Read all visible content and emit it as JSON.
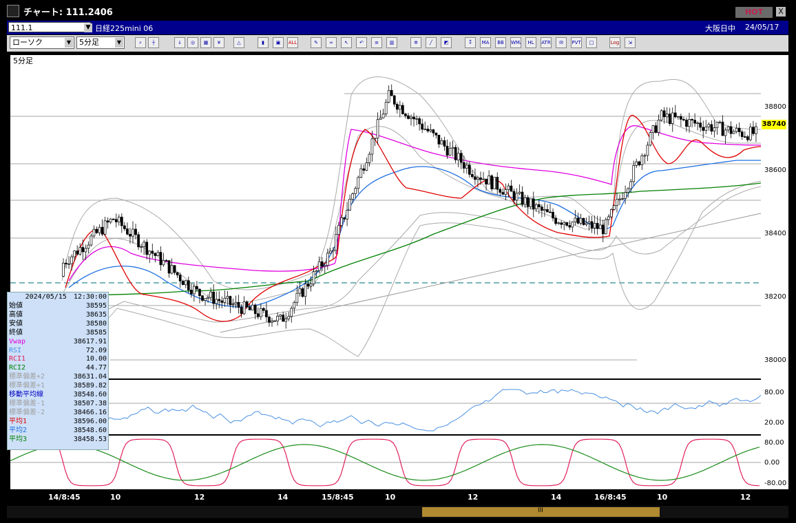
{
  "window": {
    "title": "チャート: 111.2406",
    "hot_label": "HOT",
    "close_label": "X"
  },
  "infobar": {
    "symbol": "111.1",
    "instrument": "日経225mini 06",
    "exchange": "大阪日中",
    "date": "24/05/17"
  },
  "toolbar": {
    "chart_type": "ローソク",
    "timeframe": "5分足",
    "icons": [
      "zoom-icon",
      "crosshair-icon",
      "download-icon",
      "search-icon",
      "grid-icon",
      "yen-icon",
      "drawing-icon",
      "candle-icon",
      "box-icon",
      "all-icon",
      "pencil-icon",
      "link-icon",
      "arrow-icon",
      "undo-icon",
      "list-icon",
      "trash-icon",
      "settings-icon",
      "eraser-icon",
      "color-icon",
      "ichimoku-icon",
      "ma-icon",
      "bb-icon",
      "wma-icon",
      "hl-icon",
      "atr-icon",
      "envelope-icon",
      "pvt-icon",
      "frame-icon",
      "log-icon",
      "export-icon"
    ],
    "icon_labels": {
      "all": "ALL",
      "ma": "MA",
      "bb": "BB",
      "wma": "WMA",
      "hl": "HL",
      "atr": "ATR",
      "pvt": "PVT",
      "log": "Log"
    }
  },
  "panel_label": "5分足",
  "price_axis": [
    "38800",
    "38600",
    "38400",
    "38200",
    "38000"
  ],
  "current_price": "38740",
  "rsi_axis": [
    "80.00",
    "20.00"
  ],
  "rci_axis": [
    "80.00",
    "0.00",
    "-80.00"
  ],
  "x_axis": [
    "14/8:45",
    "10",
    "12",
    "14",
    "15/8:45",
    "10",
    "12",
    "14",
    "16/8:45",
    "10",
    "12"
  ],
  "scroll_grip": "III",
  "info_panel": {
    "datetime": "2024/05/15　12:30:00",
    "rows": [
      {
        "label": "始値",
        "value": "38595",
        "color": "#000000"
      },
      {
        "label": "高値",
        "value": "38635",
        "color": "#000000"
      },
      {
        "label": "安値",
        "value": "38580",
        "color": "#000000"
      },
      {
        "label": "終値",
        "value": "38585",
        "color": "#000000"
      },
      {
        "label": "Vwap",
        "value": "38617.91",
        "color": "#e000e0"
      },
      {
        "label": "RSI",
        "value": "72.09",
        "color": "#4a90e2"
      },
      {
        "label": "RCI1",
        "value": "10.00",
        "color": "#e0205a"
      },
      {
        "label": "RCI2",
        "value": "44.77",
        "color": "#008000"
      },
      {
        "label": "標準偏差+2",
        "value": "38631.04",
        "color": "#a0a0a0"
      },
      {
        "label": "標準偏差+1",
        "value": "38589.82",
        "color": "#a0a0a0"
      },
      {
        "label": "移動平均線",
        "value": "38548.60",
        "color": "#0000c0"
      },
      {
        "label": "標準偏差-1",
        "value": "38507.38",
        "color": "#a0a0a0"
      },
      {
        "label": "標準偏差-2",
        "value": "38466.16",
        "color": "#a0a0a0"
      },
      {
        "label": "平均1",
        "value": "38596.00",
        "color": "#e00000"
      },
      {
        "label": "平均2",
        "value": "38548.60",
        "color": "#1e6fe0"
      },
      {
        "label": "平均3",
        "value": "38458.53",
        "color": "#008000"
      }
    ]
  },
  "chart_data": {
    "type": "line",
    "x": [
      "14/8:45",
      "10",
      "12",
      "14",
      "15/8:45",
      "10",
      "12",
      "14",
      "16/8:45",
      "10",
      "12"
    ],
    "ylim": [
      37950,
      38900
    ],
    "series": [
      {
        "values": [
          38250,
          38420,
          38200,
          38120,
          38320,
          38780,
          38560,
          38420,
          38390,
          38720,
          38670
        ]
      },
      {
        "values": [
          38270,
          38330,
          38200,
          38240,
          38300,
          38740,
          38630,
          38590,
          38420,
          38790,
          38680
        ]
      }
    ]
  },
  "colors": {
    "vwap": "#e000e0",
    "ma": "#1e6fe0",
    "ma_long": "#008000",
    "avg1": "#e00000",
    "bands": "#aaaaaa",
    "rsi": "#4a90e2",
    "rci1": "#e0205a",
    "rci2": "#1a8c1a"
  }
}
